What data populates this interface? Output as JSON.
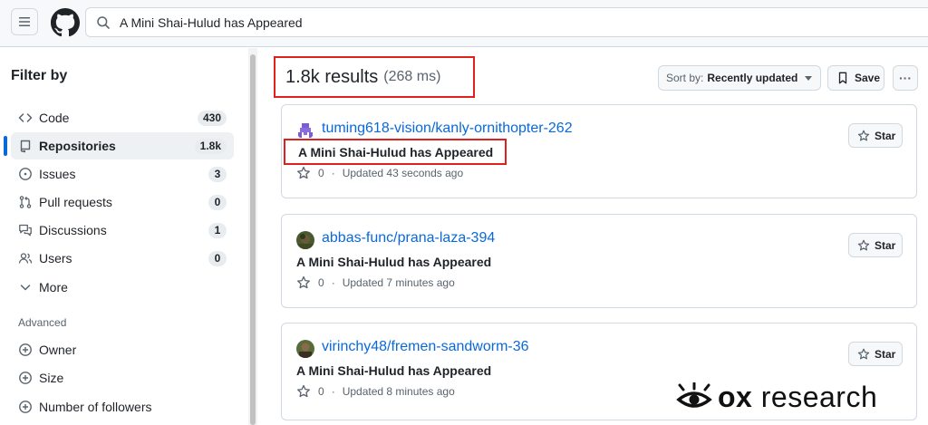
{
  "search": {
    "query": "A Mini Shai-Hulud has Appeared"
  },
  "sidebar": {
    "title": "Filter by",
    "items": [
      {
        "label": "Code",
        "count": "430",
        "icon": "code-icon"
      },
      {
        "label": "Repositories",
        "count": "1.8k",
        "icon": "repo-icon",
        "selected": true
      },
      {
        "label": "Issues",
        "count": "3",
        "icon": "issue-icon"
      },
      {
        "label": "Pull requests",
        "count": "0",
        "icon": "pull-request-icon"
      },
      {
        "label": "Discussions",
        "count": "1",
        "icon": "discussion-icon"
      },
      {
        "label": "Users",
        "count": "0",
        "icon": "people-icon"
      },
      {
        "label": "More",
        "icon": "chevron-down-icon"
      }
    ],
    "advanced_title": "Advanced",
    "advanced_items": [
      {
        "label": "Owner",
        "icon": "plus-circle-icon"
      },
      {
        "label": "Size",
        "icon": "plus-circle-icon"
      },
      {
        "label": "Number of followers",
        "icon": "plus-circle-icon"
      }
    ]
  },
  "results": {
    "count": "1.8k results",
    "time": "(268 ms)",
    "sort_prefix": "Sort by:",
    "sort_value": "Recently updated",
    "save_label": "Save"
  },
  "repos": [
    {
      "name": "tuming618-vision/kanly-ornithopter-262",
      "description": "A Mini Shai-Hulud has Appeared",
      "stars": "0",
      "updated": "Updated 43 seconds ago",
      "star_label": "Star"
    },
    {
      "name": "abbas-func/prana-laza-394",
      "description": "A Mini Shai-Hulud has Appeared",
      "stars": "0",
      "updated": "Updated 7 minutes ago",
      "star_label": "Star"
    },
    {
      "name": "virinchy48/fremen-sandworm-36",
      "description": "A Mini Shai-Hulud has Appeared",
      "stars": "0",
      "updated": "Updated 8 minutes ago",
      "star_label": "Star"
    }
  ],
  "watermark": {
    "brand": "ox",
    "suffix": "research"
  },
  "colors": {
    "link": "#0969da",
    "highlight_box": "#e0201c",
    "selected_bar": "#0969da"
  }
}
